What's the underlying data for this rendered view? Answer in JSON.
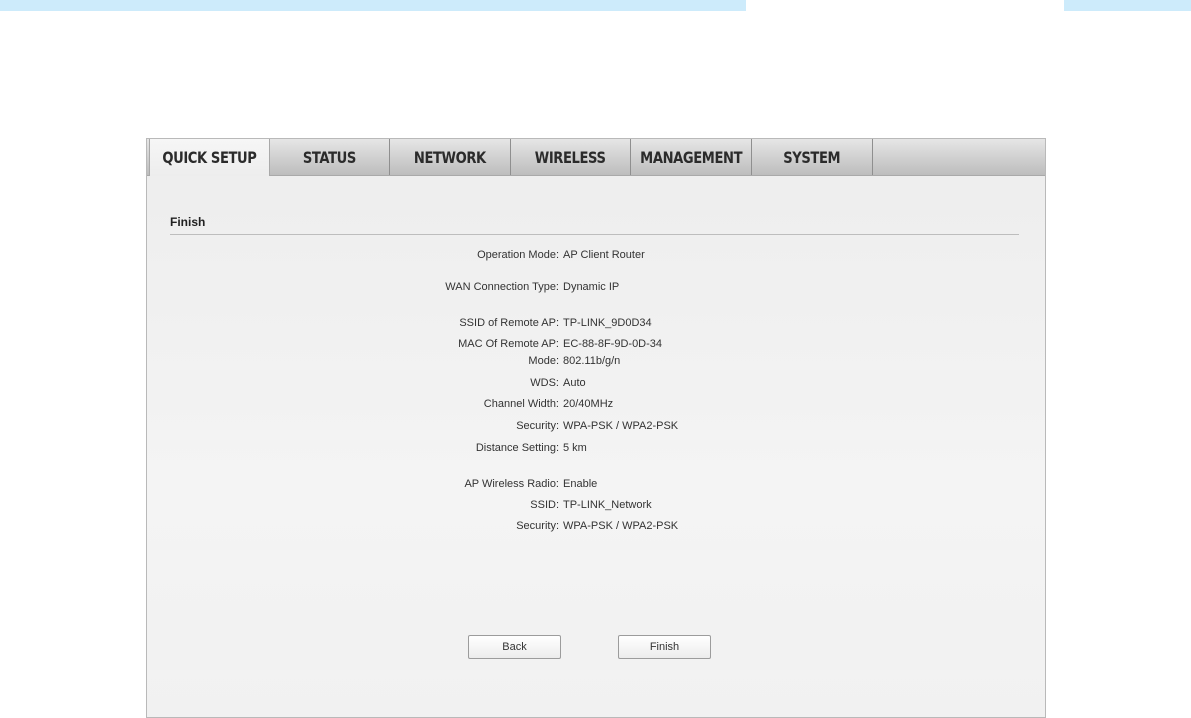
{
  "tabs": [
    {
      "label": "QUICK SETUP",
      "active": true
    },
    {
      "label": "STATUS",
      "active": false
    },
    {
      "label": "NETWORK",
      "active": false
    },
    {
      "label": "WIRELESS",
      "active": false
    },
    {
      "label": "MANAGEMENT",
      "active": false
    },
    {
      "label": "SYSTEM",
      "active": false
    }
  ],
  "section": {
    "title": "Finish"
  },
  "summary": [
    {
      "label": "Operation Mode:",
      "value": "AP Client Router"
    },
    {
      "label": "WAN Connection Type:",
      "value": "Dynamic IP"
    },
    {
      "label": "SSID of Remote AP:",
      "value": "TP-LINK_9D0D34"
    },
    {
      "label": "MAC Of Remote AP:",
      "value": "EC-88-8F-9D-0D-34"
    },
    {
      "label": "Mode:",
      "value": "802.11b/g/n"
    },
    {
      "label": "WDS:",
      "value": "Auto"
    },
    {
      "label": "Channel Width:",
      "value": "20/40MHz"
    },
    {
      "label": "Security:",
      "value": "WPA-PSK / WPA2-PSK"
    },
    {
      "label": "Distance Setting:",
      "value": "5 km"
    },
    {
      "label": "AP Wireless Radio:",
      "value": "Enable"
    },
    {
      "label": "SSID:",
      "value": "TP-LINK_Network"
    },
    {
      "label": "Security:",
      "value": "WPA-PSK / WPA2-PSK"
    }
  ],
  "buttons": {
    "back": "Back",
    "finish": "Finish"
  },
  "colors": {
    "top_strip": "#cdebfb",
    "panel_bg": "#f1f1f1"
  }
}
